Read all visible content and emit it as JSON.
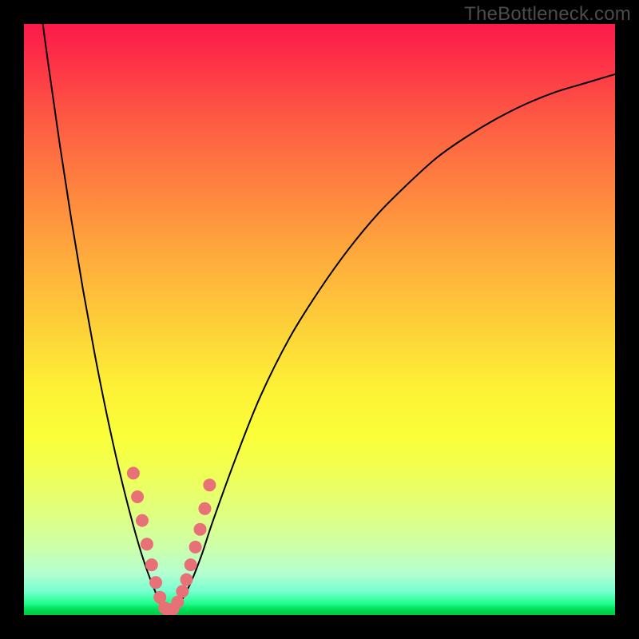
{
  "watermark": "TheBottleneck.com",
  "chart_data": {
    "type": "line",
    "title": "",
    "xlabel": "",
    "ylabel": "",
    "x_range": [
      0,
      100
    ],
    "y_range": [
      0,
      100
    ],
    "minimum_x": 24,
    "series": [
      {
        "name": "bottleneck-curve",
        "x": [
          2,
          4,
          6,
          8,
          10,
          12,
          14,
          16,
          18,
          20,
          22,
          24,
          26,
          28,
          30,
          32,
          36,
          40,
          45,
          50,
          55,
          60,
          65,
          70,
          75,
          80,
          85,
          90,
          95,
          100
        ],
        "y": [
          109,
          94,
          80,
          67,
          55,
          44,
          34,
          25,
          17,
          10,
          4.5,
          0.5,
          1.5,
          5,
          10,
          16,
          27,
          37,
          47,
          55,
          62,
          68,
          73,
          77.5,
          81,
          84,
          86.5,
          88.5,
          90,
          91.5
        ]
      }
    ],
    "markers": {
      "name": "sample-points",
      "x": [
        18.5,
        19.2,
        20.0,
        20.8,
        21.6,
        22.3,
        23.0,
        23.8,
        24.5,
        25.2,
        26.0,
        26.8,
        27.5,
        28.2,
        29.0,
        29.8,
        30.6,
        31.4
      ],
      "y": [
        24,
        20,
        16,
        12,
        8.5,
        5.5,
        3,
        1.2,
        0.6,
        1.0,
        2.2,
        4,
        6,
        8.5,
        11.5,
        14.5,
        18,
        22
      ],
      "radius": 8
    },
    "gradient_stops": [
      {
        "pct": 0,
        "color": "#fc1a4a"
      },
      {
        "pct": 28,
        "color": "#fe843f"
      },
      {
        "pct": 62,
        "color": "#fdf236"
      },
      {
        "pct": 96,
        "color": "#76ffd0"
      },
      {
        "pct": 100,
        "color": "#00c83f"
      }
    ]
  }
}
